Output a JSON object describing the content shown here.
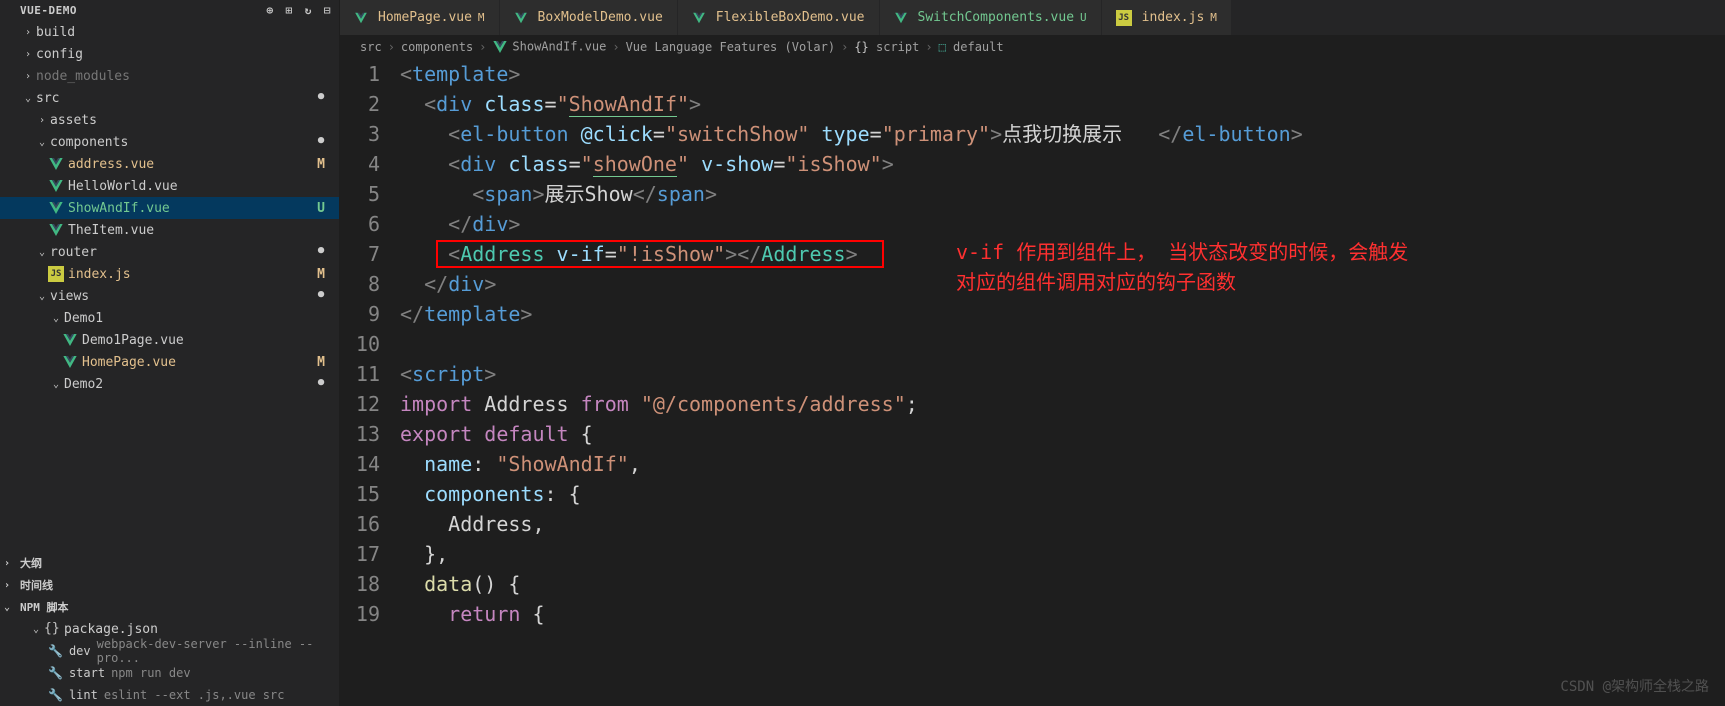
{
  "sidebar": {
    "project": "VUE-DEMO",
    "tree": [
      {
        "indent": 1,
        "chev": "›",
        "name": "build",
        "status": ""
      },
      {
        "indent": 1,
        "chev": "›",
        "name": "config",
        "status": ""
      },
      {
        "indent": 1,
        "chev": "›",
        "name": "node_modules",
        "status": "",
        "dim": true
      },
      {
        "indent": 1,
        "chev": "⌄",
        "name": "src",
        "status": "dot"
      },
      {
        "indent": 2,
        "chev": "›",
        "name": "assets",
        "status": ""
      },
      {
        "indent": 2,
        "chev": "⌄",
        "name": "components",
        "status": "dot"
      },
      {
        "indent": 3,
        "icon": "vue",
        "name": "address.vue",
        "status": "M",
        "cls": "modified"
      },
      {
        "indent": 3,
        "icon": "vue",
        "name": "HelloWorld.vue",
        "status": ""
      },
      {
        "indent": 3,
        "icon": "vue",
        "name": "ShowAndIf.vue",
        "status": "U",
        "cls": "untracked",
        "selected": true
      },
      {
        "indent": 3,
        "icon": "vue",
        "name": "TheItem.vue",
        "status": ""
      },
      {
        "indent": 2,
        "chev": "⌄",
        "name": "router",
        "status": "dot"
      },
      {
        "indent": 3,
        "icon": "js",
        "name": "index.js",
        "status": "M",
        "cls": "modified"
      },
      {
        "indent": 2,
        "chev": "⌄",
        "name": "views",
        "status": "dot"
      },
      {
        "indent": 3,
        "chev": "⌄",
        "name": "Demo1",
        "status": ""
      },
      {
        "indent": 4,
        "icon": "vue",
        "name": "Demo1Page.vue",
        "status": ""
      },
      {
        "indent": 4,
        "icon": "vue",
        "name": "HomePage.vue",
        "status": "M",
        "cls": "modified"
      },
      {
        "indent": 3,
        "chev": "⌄",
        "name": "Demo2",
        "status": "dot"
      }
    ],
    "sections": [
      "大纲",
      "时间线",
      "NPM 脚本"
    ],
    "npm_pkg": "package.json",
    "scripts": [
      {
        "name": "dev",
        "cmd": "webpack-dev-server --inline --pro..."
      },
      {
        "name": "start",
        "cmd": "npm run dev"
      },
      {
        "name": "lint",
        "cmd": "eslint --ext .js,.vue src"
      }
    ]
  },
  "tabs": [
    {
      "icon": "vue",
      "name": "HomePage.vue",
      "mark": "M"
    },
    {
      "icon": "vue",
      "name": "BoxModelDemo.vue",
      "mark": ""
    },
    {
      "icon": "vue",
      "name": "FlexibleBoxDemo.vue",
      "mark": ""
    },
    {
      "icon": "vue",
      "name": "SwitchComponents.vue",
      "mark": "U"
    },
    {
      "icon": "js",
      "name": "index.js",
      "mark": "M"
    }
  ],
  "breadcrumb": [
    "src",
    "components",
    "ShowAndIf.vue",
    "Vue Language Features (Volar)",
    "script",
    "default"
  ],
  "code_lines": [
    "1",
    "2",
    "3",
    "4",
    "5",
    "6",
    "7",
    "8",
    "9",
    "10",
    "11",
    "12",
    "13",
    "14",
    "15",
    "16",
    "17",
    "18",
    "19"
  ],
  "code": {
    "l1": {
      "a": "<",
      "b": "template",
      "c": ">"
    },
    "l2": {
      "a": "<",
      "b": "div",
      "c": " class",
      "d": "=",
      "e": "\"",
      "f": "ShowAndIf",
      "g": "\"",
      "h": ">"
    },
    "l3": {
      "a": "<",
      "b": "el-button",
      "c": " @click",
      "d": "=",
      "e": "\"switchShow\"",
      "f": " type",
      "g": "=",
      "h": "\"primary\"",
      "i": ">",
      "j": "点我切换展示   ",
      "k": "</",
      "l": "el-button",
      "m": ">"
    },
    "l4": {
      "a": "<",
      "b": "div",
      "c": " class",
      "d": "=",
      "e": "\"",
      "f": "showOne",
      "g": "\"",
      "h": " v-show",
      "i": "=",
      "j": "\"isShow\"",
      "k": ">"
    },
    "l5": {
      "a": "<",
      "b": "span",
      "c": ">",
      "d": "展示Show",
      "e": "</",
      "f": "span",
      "g": ">"
    },
    "l6": {
      "a": "</",
      "b": "div",
      "c": ">"
    },
    "l7": {
      "a": "<",
      "b": "Address",
      "c": " v-if",
      "d": "=",
      "e": "\"!isShow\"",
      "f": "></",
      "g": "Address",
      "h": ">"
    },
    "l8": {
      "a": "</",
      "b": "div",
      "c": ">"
    },
    "l9": {
      "a": "</",
      "b": "template",
      "c": ">"
    },
    "l11": {
      "a": "<",
      "b": "script",
      "c": ">"
    },
    "l12": {
      "a": "import",
      "b": " Address ",
      "c": "from",
      "d": " \"@/components/address\"",
      "e": ";"
    },
    "l13": {
      "a": "export",
      "b": " default",
      "c": " {"
    },
    "l14": {
      "a": "name",
      "b": ": ",
      "c": "\"ShowAndIf\"",
      "d": ","
    },
    "l15": {
      "a": "components",
      "b": ": {"
    },
    "l16": {
      "a": "Address",
      "b": ","
    },
    "l17": {
      "a": "},"
    },
    "l18": {
      "a": "data",
      "b": "() {"
    },
    "l19": {
      "a": "return",
      "b": " {"
    }
  },
  "annotation": {
    "line1": "v-if 作用到组件上， 当状态改变的时候，会触发",
    "line2": "对应的组件调用对应的钩子函数"
  },
  "watermark": "CSDN @架构师全栈之路"
}
